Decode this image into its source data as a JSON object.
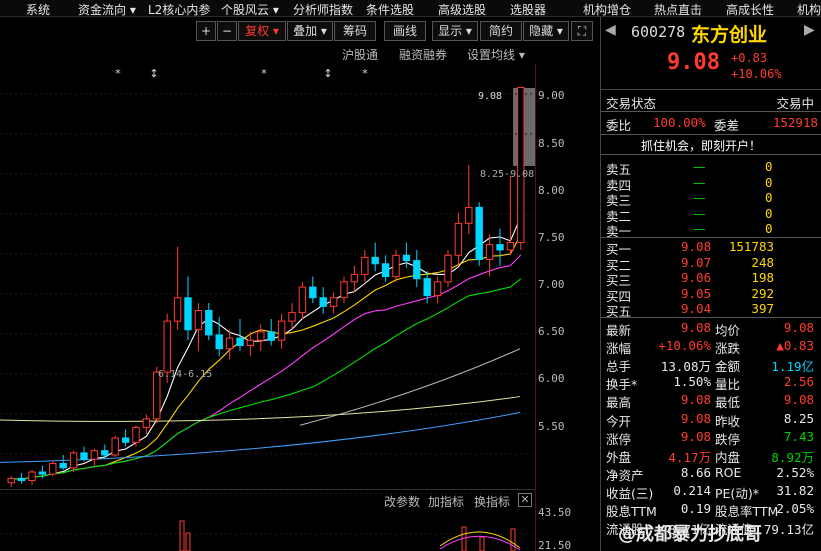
{
  "top_menu": [
    "系统",
    "资金流向 ▾",
    "L2核心内参",
    "个股风云 ▾",
    "分析师指数",
    "条件选股",
    "高级选股",
    "选股器",
    "机构增仓",
    "热点直击",
    "高成长性",
    "机构"
  ],
  "toolbar": {
    "plus": "+",
    "minus": "−",
    "fuquan": "复权 ▾",
    "diejia": "叠加 ▾",
    "chouma": "筹码",
    "huaxian": "画线",
    "xianshi": "显示 ▾",
    "jianyue": "简约",
    "yincang": "隐藏 ▾",
    "expand": "⛶"
  },
  "subtool": {
    "hgt": "沪股通",
    "rzrq": "融资融券",
    "ma_setting": "设置均线 ▾"
  },
  "markers": [
    "*",
    "↕",
    "*",
    "↕",
    "*"
  ],
  "chart_data": {
    "type": "candlestick",
    "ylim": [
      5.3,
      9.3
    ],
    "yticks": [
      "9.00",
      "8.50",
      "8.00",
      "7.50",
      "7.00",
      "6.50",
      "6.00",
      "5.50"
    ],
    "annotations": {
      "high": "9.08",
      "range": "8.25-9.08",
      "low_range": "6.14-6.15"
    },
    "candles": [
      [
        5.36,
        5.42,
        5.32,
        5.4
      ],
      [
        5.4,
        5.45,
        5.35,
        5.38
      ],
      [
        5.38,
        5.48,
        5.34,
        5.46
      ],
      [
        5.46,
        5.52,
        5.4,
        5.44
      ],
      [
        5.44,
        5.56,
        5.42,
        5.54
      ],
      [
        5.54,
        5.62,
        5.48,
        5.5
      ],
      [
        5.5,
        5.66,
        5.46,
        5.64
      ],
      [
        5.64,
        5.7,
        5.56,
        5.58
      ],
      [
        5.58,
        5.68,
        5.52,
        5.66
      ],
      [
        5.66,
        5.72,
        5.58,
        5.62
      ],
      [
        5.62,
        5.8,
        5.6,
        5.78
      ],
      [
        5.78,
        5.86,
        5.7,
        5.74
      ],
      [
        5.74,
        5.9,
        5.7,
        5.88
      ],
      [
        5.88,
        6.0,
        5.82,
        5.96
      ],
      [
        5.96,
        6.45,
        5.92,
        6.4
      ],
      [
        6.4,
        6.95,
        6.3,
        6.88
      ],
      [
        6.88,
        7.58,
        6.8,
        7.1
      ],
      [
        7.1,
        7.3,
        6.7,
        6.8
      ],
      [
        6.8,
        7.05,
        6.6,
        6.98
      ],
      [
        6.98,
        7.05,
        6.7,
        6.75
      ],
      [
        6.75,
        6.92,
        6.55,
        6.62
      ],
      [
        6.62,
        6.8,
        6.52,
        6.72
      ],
      [
        6.72,
        6.9,
        6.6,
        6.65
      ],
      [
        6.65,
        6.78,
        6.55,
        6.7
      ],
      [
        6.7,
        6.85,
        6.6,
        6.78
      ],
      [
        6.78,
        6.9,
        6.65,
        6.7
      ],
      [
        6.7,
        6.95,
        6.62,
        6.88
      ],
      [
        6.88,
        7.05,
        6.8,
        6.96
      ],
      [
        6.96,
        7.25,
        6.9,
        7.2
      ],
      [
        7.2,
        7.3,
        7.05,
        7.1
      ],
      [
        7.1,
        7.2,
        6.95,
        7.02
      ],
      [
        7.02,
        7.15,
        6.95,
        7.1
      ],
      [
        7.1,
        7.3,
        7.05,
        7.25
      ],
      [
        7.25,
        7.4,
        7.15,
        7.32
      ],
      [
        7.32,
        7.55,
        7.25,
        7.48
      ],
      [
        7.48,
        7.62,
        7.35,
        7.42
      ],
      [
        7.42,
        7.5,
        7.25,
        7.3
      ],
      [
        7.3,
        7.55,
        7.25,
        7.5
      ],
      [
        7.5,
        7.62,
        7.38,
        7.45
      ],
      [
        7.45,
        7.55,
        7.2,
        7.28
      ],
      [
        7.28,
        7.35,
        7.05,
        7.12
      ],
      [
        7.12,
        7.3,
        7.05,
        7.25
      ],
      [
        7.25,
        7.55,
        7.2,
        7.5
      ],
      [
        7.5,
        7.9,
        7.4,
        7.8
      ],
      [
        7.8,
        8.35,
        7.7,
        7.95
      ],
      [
        7.95,
        8.0,
        7.4,
        7.46
      ],
      [
        7.46,
        7.7,
        7.3,
        7.6
      ],
      [
        7.6,
        7.75,
        7.4,
        7.55
      ],
      [
        7.55,
        8.25,
        7.5,
        7.62
      ],
      [
        7.62,
        9.08,
        7.55,
        9.08
      ]
    ]
  },
  "indicator": {
    "gaican": "改参数",
    "jiazhi": "加指标",
    "huanzhi": "换指标",
    "close": "✕",
    "y1": "43.50",
    "y2": "21.50"
  },
  "quote": {
    "code": "600278",
    "name": "东方创业",
    "price": "9.08",
    "change": "+0.83",
    "pct": "+10.06%",
    "status_label": "交易状态",
    "status": "交易中",
    "weibi_label": "委比",
    "weibi": "100.00%",
    "weicha_label": "委差",
    "weicha": "152918",
    "banner": "抓住机会，即刻开户！",
    "asks": [
      {
        "label": "卖五",
        "price": "—",
        "vol": "0"
      },
      {
        "label": "卖四",
        "price": "—",
        "vol": "0"
      },
      {
        "label": "卖三",
        "price": "—",
        "vol": "0"
      },
      {
        "label": "卖二",
        "price": "—",
        "vol": "0"
      },
      {
        "label": "卖一",
        "price": "—",
        "vol": "0"
      }
    ],
    "bids": [
      {
        "label": "买一",
        "price": "9.08",
        "vol": "151783"
      },
      {
        "label": "买二",
        "price": "9.07",
        "vol": "248"
      },
      {
        "label": "买三",
        "price": "9.06",
        "vol": "198"
      },
      {
        "label": "买四",
        "price": "9.05",
        "vol": "292"
      },
      {
        "label": "买五",
        "price": "9.04",
        "vol": "397"
      }
    ],
    "stats": [
      {
        "l1": "最新",
        "v1": "9.08",
        "c1": "up",
        "l2": "均价",
        "v2": "9.08",
        "c2": "up"
      },
      {
        "l1": "涨幅",
        "v1": "+10.06%",
        "c1": "up",
        "l2": "涨跌",
        "v2": "▲0.83",
        "c2": "up"
      },
      {
        "l1": "总手",
        "v1": "13.08万",
        "c1": "white",
        "l2": "金额",
        "v2": "1.19亿",
        "c2": "cyan"
      },
      {
        "l1": "换手*",
        "v1": "1.50%",
        "c1": "white",
        "l2": "量比",
        "v2": "2.56",
        "c2": "up"
      },
      {
        "l1": "最高",
        "v1": "9.08",
        "c1": "up",
        "l2": "最低",
        "v2": "9.08",
        "c2": "up"
      },
      {
        "l1": "今开",
        "v1": "9.08",
        "c1": "up",
        "l2": "昨收",
        "v2": "8.25",
        "c2": "white"
      },
      {
        "l1": "涨停",
        "v1": "9.08",
        "c1": "up",
        "l2": "跌停",
        "v2": "7.43",
        "c2": "green"
      },
      {
        "l1": "外盘",
        "v1": "4.17万",
        "c1": "up",
        "l2": "内盘",
        "v2": "8.92万",
        "c2": "green"
      },
      {
        "l1": "净资产",
        "v1": "8.66",
        "c1": "white",
        "l2": "ROE",
        "v2": "2.52%",
        "c2": "white"
      },
      {
        "l1": "收益(三)",
        "v1": "0.214",
        "c1": "white",
        "l2": "PE(动)*",
        "v2": "31.82",
        "c2": "white"
      },
      {
        "l1": "股息TTM",
        "v1": "0.19",
        "c1": "white",
        "l2": "股息率TTM",
        "v2": "2.05%",
        "c2": "white"
      },
      {
        "l1": "流通股",
        "v1": "8.71亿",
        "c1": "white",
        "l2": "流通值",
        "v2": "79.13亿",
        "c2": "white"
      }
    ]
  },
  "watermark": "@成都暴力抄底哥",
  "colors": {
    "up": "#ff3b30",
    "down": "#00d5ff",
    "ma5": "#ffffff",
    "ma10": "#ffd700",
    "ma20": "#ff40ff",
    "ma60": "#00e000"
  }
}
